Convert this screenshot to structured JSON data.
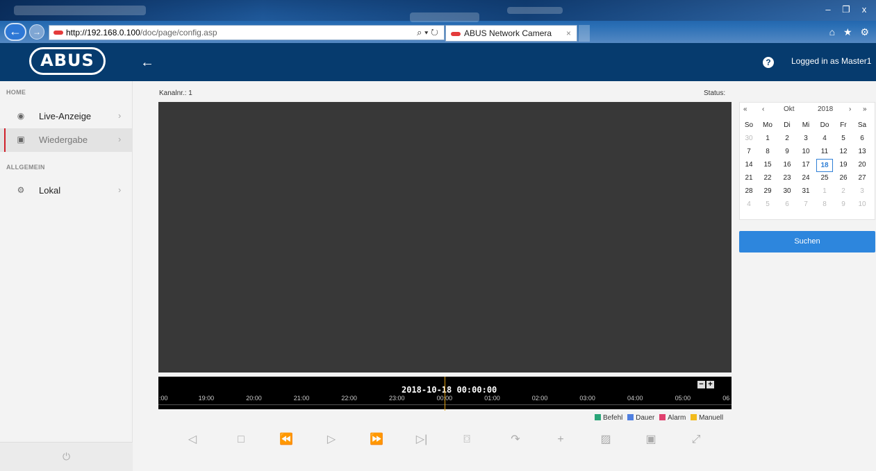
{
  "browser": {
    "url_host": "http://192.168.0.100",
    "url_path": "/doc/page/config.asp",
    "url_tools": "⌕ ▾ ↻",
    "tab_title": "ABUS Network Camera",
    "tab_close": "×",
    "window_controls": [
      "–",
      "❐",
      "x"
    ],
    "toolbar_icons": "⌂ ★ ⚙"
  },
  "header": {
    "logo_text": "ABUS",
    "back_glyph": "←",
    "help_glyph": "?",
    "logged_in_text": "Logged in as Master1"
  },
  "sidebar": {
    "section_home": "HOME",
    "section_general": "ALLGEMEIN",
    "items": [
      {
        "label": "Live-Anzeige",
        "icon": "eye-icon",
        "glyph": "◉",
        "chevron": "›"
      },
      {
        "label": "Wiedergabe",
        "icon": "playback-icon",
        "glyph": "▣",
        "chevron": "›"
      },
      {
        "label": "Lokal",
        "icon": "local-settings-icon",
        "glyph": "⚙",
        "chevron": "›"
      }
    ],
    "power_glyph": "⏻"
  },
  "main": {
    "channel_label": "Kanalnr.: 1",
    "status_label": "Status:"
  },
  "timeline": {
    "datetime": "2018-10-18 00:00:00",
    "hours": [
      ":00",
      "19:00",
      "20:00",
      "21:00",
      "22:00",
      "23:00",
      "00:00",
      "01:00",
      "02:00",
      "03:00",
      "04:00",
      "05:00",
      "06"
    ],
    "zoom_out": "−",
    "zoom_in": "+"
  },
  "legend": [
    {
      "label": "Befehl",
      "color": "#2aa578"
    },
    {
      "label": "Dauer",
      "color": "#4f7fe0"
    },
    {
      "label": "Alarm",
      "color": "#e0406e"
    },
    {
      "label": "Manuell",
      "color": "#f2bb1c"
    }
  ],
  "controls": [
    {
      "name": "previous-frame-button",
      "glyph": "◁"
    },
    {
      "name": "stop-button",
      "glyph": "□"
    },
    {
      "name": "rewind-button",
      "glyph": "⏪"
    },
    {
      "name": "play-button",
      "glyph": "▷"
    },
    {
      "name": "fast-forward-button",
      "glyph": "⏩"
    },
    {
      "name": "next-frame-button",
      "glyph": "▷|"
    },
    {
      "name": "snapshot-button",
      "glyph": "⌼"
    },
    {
      "name": "clip-button",
      "glyph": "↷"
    },
    {
      "name": "digital-zoom-button",
      "glyph": "+"
    },
    {
      "name": "download-button",
      "glyph": "▨"
    },
    {
      "name": "picture-button",
      "glyph": "▣"
    },
    {
      "name": "fullscreen-button",
      "glyph": "⤢"
    }
  ],
  "calendar": {
    "nav_prev_year": "«",
    "nav_prev_month": "‹",
    "month": "Okt",
    "year": "2018",
    "nav_next_month": "›",
    "nav_next_year": "»",
    "weekdays": [
      "So",
      "Mo",
      "Di",
      "Mi",
      "Do",
      "Fr",
      "Sa"
    ],
    "weeks": [
      [
        {
          "d": "30",
          "dim": true
        },
        {
          "d": "1"
        },
        {
          "d": "2"
        },
        {
          "d": "3"
        },
        {
          "d": "4"
        },
        {
          "d": "5"
        },
        {
          "d": "6"
        }
      ],
      [
        {
          "d": "7"
        },
        {
          "d": "8"
        },
        {
          "d": "9"
        },
        {
          "d": "10"
        },
        {
          "d": "11"
        },
        {
          "d": "12"
        },
        {
          "d": "13"
        }
      ],
      [
        {
          "d": "14"
        },
        {
          "d": "15"
        },
        {
          "d": "16"
        },
        {
          "d": "17"
        },
        {
          "d": "18",
          "sel": true
        },
        {
          "d": "19"
        },
        {
          "d": "20"
        }
      ],
      [
        {
          "d": "21"
        },
        {
          "d": "22"
        },
        {
          "d": "23"
        },
        {
          "d": "24"
        },
        {
          "d": "25"
        },
        {
          "d": "26"
        },
        {
          "d": "27"
        }
      ],
      [
        {
          "d": "28"
        },
        {
          "d": "29"
        },
        {
          "d": "30"
        },
        {
          "d": "31"
        },
        {
          "d": "1",
          "dim": true
        },
        {
          "d": "2",
          "dim": true
        },
        {
          "d": "3",
          "dim": true
        }
      ],
      [
        {
          "d": "4",
          "dim": true
        },
        {
          "d": "5",
          "dim": true
        },
        {
          "d": "6",
          "dim": true
        },
        {
          "d": "7",
          "dim": true
        },
        {
          "d": "8",
          "dim": true
        },
        {
          "d": "9",
          "dim": true
        },
        {
          "d": "10",
          "dim": true
        }
      ]
    ],
    "search_label": "Suchen"
  }
}
